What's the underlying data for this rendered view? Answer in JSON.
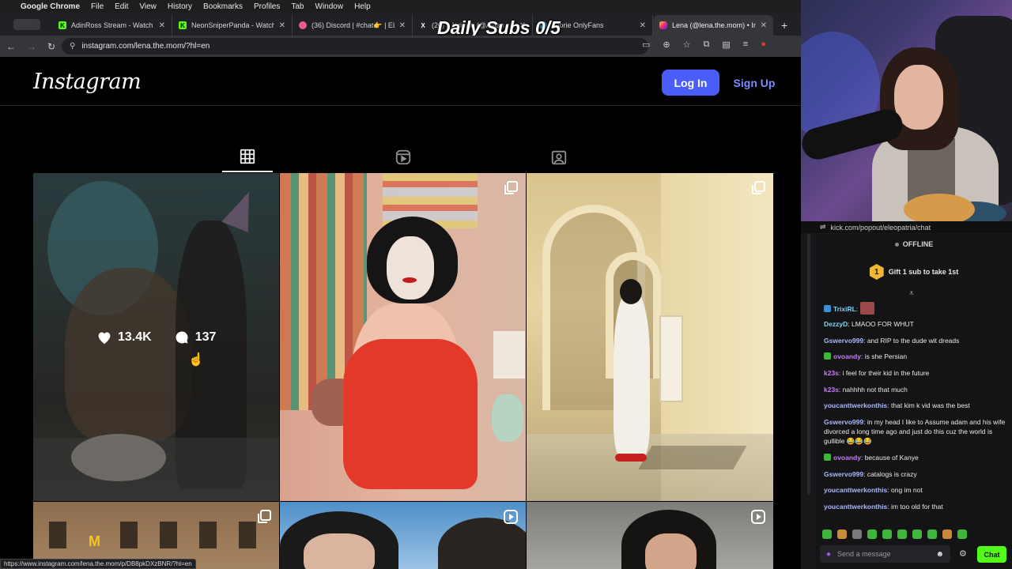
{
  "menubar": {
    "app_name": "Google Chrome",
    "items": [
      "File",
      "Edit",
      "View",
      "History",
      "Bookmarks",
      "Profiles",
      "Tab",
      "Window",
      "Help"
    ]
  },
  "tabs": [
    {
      "title": "AdinRoss Stream - Watch Li",
      "favicon": "kick-icon",
      "favicon_color": "#53fc18"
    },
    {
      "title": "NeonSniperPanda - Watch L",
      "favicon": "kick-icon",
      "favicon_color": "#53fc18"
    },
    {
      "title": "(36) Discord | #chat👉 | ELL",
      "favicon": "discord-icon",
      "favicon_color": "#ed5a8a"
    },
    {
      "title": "(20) ...lorie🙈 (@Asian",
      "favicon": "x-icon",
      "favicon_color": "#ffffff"
    },
    {
      "title": "...lorie OnlyFans",
      "favicon": "onlyfans-icon",
      "favicon_color": "#2a9df4"
    },
    {
      "title": "Lena (@lena.the.mom) • Ins",
      "favicon": "instagram-icon",
      "favicon_color": "#e1306c",
      "active": true
    }
  ],
  "overlay": {
    "daily_subs": "Daily Subs 0/5"
  },
  "address_bar": {
    "url": "instagram.com/lena.the.mom/?hl=en"
  },
  "instagram": {
    "logo": "Instagram",
    "login_label": "Log In",
    "signup_label": "Sign Up",
    "tabs": [
      "posts-grid",
      "reels",
      "tagged"
    ],
    "hover_post": {
      "likes": "13.4K",
      "comments": "137"
    }
  },
  "statusbar": {
    "link": "https://www.instagram.com/lena.the.mom/p/DB8pkDXzBNR/?hl=en"
  },
  "stream_chat": {
    "url": "kick.com/popout/eleopatria/chat",
    "status": "OFFLINE",
    "gift_badge": "1",
    "gift_text": "Gift 1 sub to take 1st",
    "messages": [
      {
        "user": "TrixiRL",
        "color": "#7ed5f0",
        "text": "",
        "badge": "blue",
        "emote": true
      },
      {
        "user": "DezzyD",
        "color": "#7ed5f0",
        "text": "LMAOO FOR WHUT"
      },
      {
        "user": "Gswervo999",
        "color": "#a8b8ff",
        "text": "and RIP to the dude wit dreads"
      },
      {
        "user": "ovoandy",
        "color": "#c67cf5",
        "text": "is she Persian",
        "badge": "green"
      },
      {
        "user": "k23s",
        "color": "#c67cf5",
        "text": "i feel for their kid in the future"
      },
      {
        "user": "k23s",
        "color": "#c67cf5",
        "text": "nahhhh not that much"
      },
      {
        "user": "youcanttwerkonthis",
        "color": "#a8b8ff",
        "text": "that kim k vid was the best"
      },
      {
        "user": "Gswervo999",
        "color": "#a8b8ff",
        "text": "in my head I like to Assume adam and his wife divorced a long time ago and just do this cuz the world is gullible 😂😂😂"
      },
      {
        "user": "ovoandy",
        "color": "#c67cf5",
        "text": "because of Kanye",
        "badge": "green"
      },
      {
        "user": "Gswervo999",
        "color": "#a8b8ff",
        "text": "catalogs is crazy"
      },
      {
        "user": "youcanttwerkonthis",
        "color": "#a8b8ff",
        "text": "ong im not"
      },
      {
        "user": "youcanttwerkonthis",
        "color": "#a8b8ff",
        "text": "im too old for that"
      }
    ],
    "input_placeholder": "Send a message",
    "chat_button": "Chat"
  }
}
